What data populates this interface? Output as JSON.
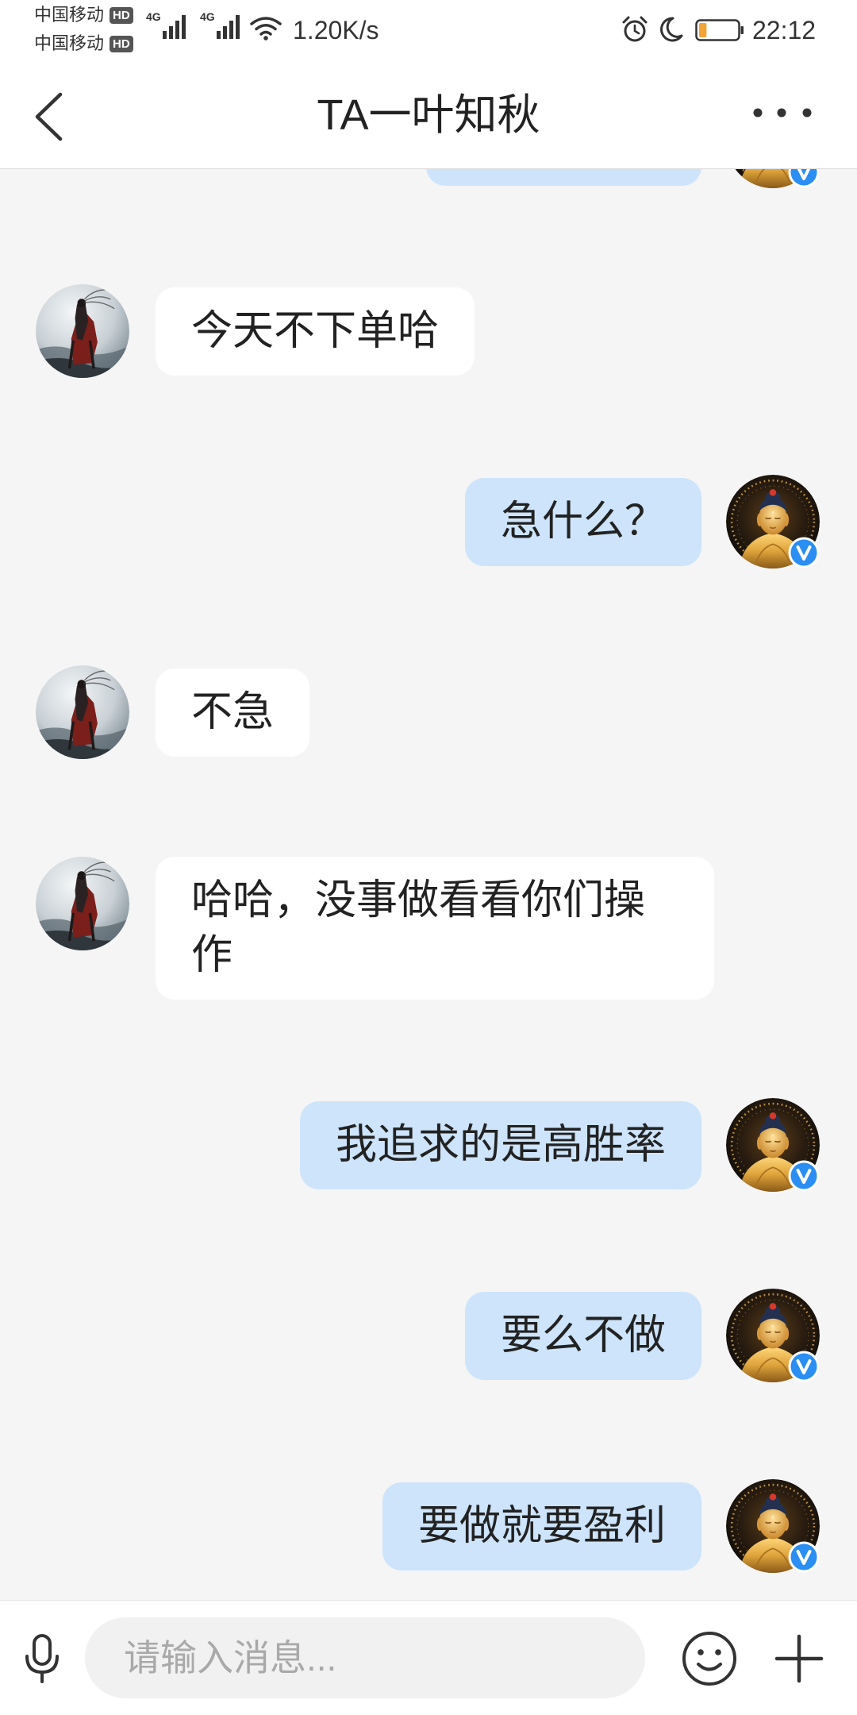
{
  "status_bar": {
    "carriers": [
      {
        "name": "中国移动",
        "badge": "HD"
      },
      {
        "name": "中国移动",
        "badge": "HD"
      }
    ],
    "signals": [
      {
        "network": "4G",
        "icon": "signal-bars-icon"
      },
      {
        "network": "4G",
        "icon": "signal-bars-icon"
      }
    ],
    "wifi_icon": "wifi-icon",
    "net_speed": "1.20K/s",
    "alarm_icon": "alarm-clock-icon",
    "do_not_disturb_icon": "moon-icon",
    "battery": {
      "icon": "battery-icon",
      "level": 0.2
    },
    "time": "22:12"
  },
  "header": {
    "back_icon": "chevron-left-icon",
    "title": "TA一叶知秋",
    "more_icon": "more-dots-icon"
  },
  "messages": [
    {
      "text": "今天不下单哈"
    },
    {
      "text": "急什么？"
    },
    {
      "text": "不急"
    },
    {
      "text": "哈哈，没事做看看你们操作"
    },
    {
      "text": "我追求的是高胜率"
    },
    {
      "text": "要么不做"
    },
    {
      "text": "要做就要盈利"
    }
  ],
  "input_bar": {
    "mic_icon": "microphone-icon",
    "placeholder": "请输入消息...",
    "emoji_icon": "emoji-icon",
    "plus_icon": "plus-icon"
  },
  "colors": {
    "chat_background": "#f5f5f5",
    "bubble_mine": "#cde4fb",
    "bubble_other": "#ffffff",
    "verified_badge": "#2b8ef2",
    "battery_fill": "#f2a33a"
  }
}
